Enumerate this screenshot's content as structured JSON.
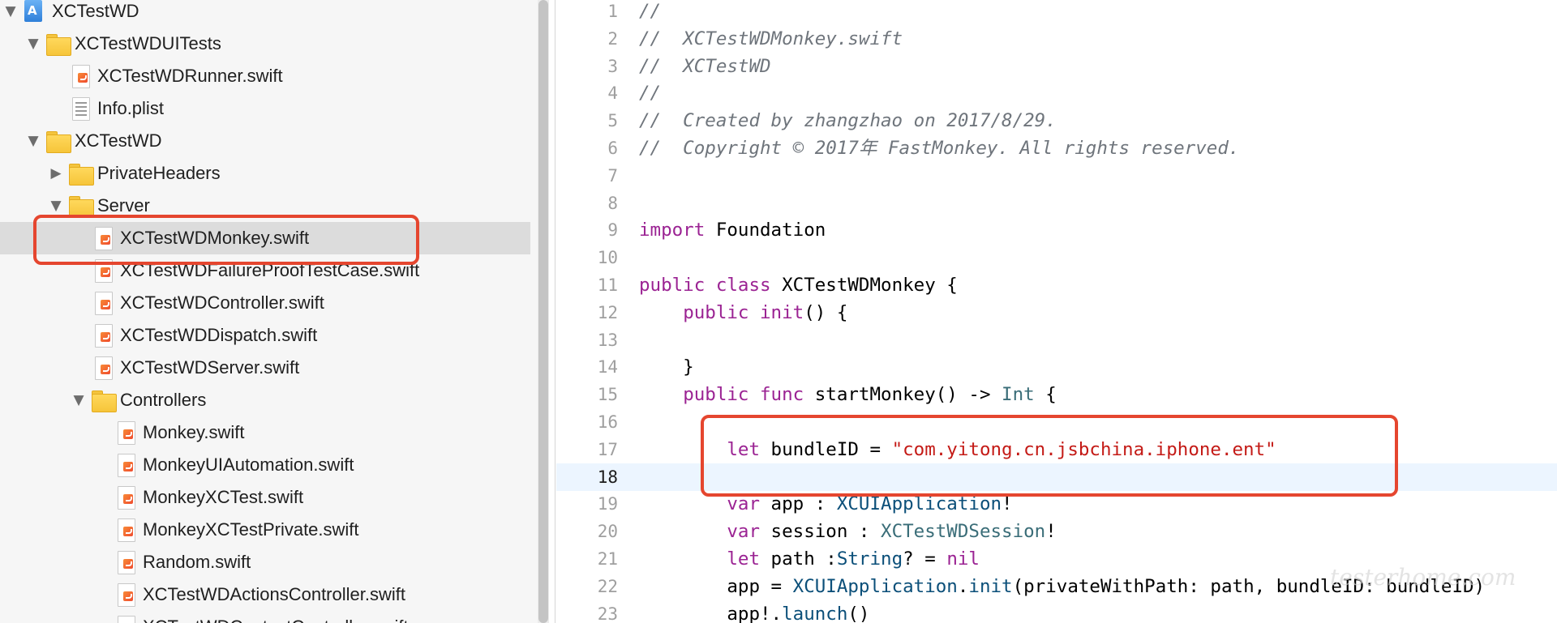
{
  "navigator": {
    "items": [
      {
        "label": "XCTestWD",
        "icon": "project-icon",
        "indent": 0,
        "disclosure": "expanded"
      },
      {
        "label": "XCTestWDUITests",
        "icon": "folder-icon",
        "indent": 1,
        "disclosure": "expanded"
      },
      {
        "label": "XCTestWDRunner.swift",
        "icon": "swift-file-icon",
        "indent": 2,
        "disclosure": "none"
      },
      {
        "label": "Info.plist",
        "icon": "plist-file-icon",
        "indent": 2,
        "disclosure": "none"
      },
      {
        "label": "XCTestWD",
        "icon": "folder-icon",
        "indent": 1,
        "disclosure": "expanded"
      },
      {
        "label": "PrivateHeaders",
        "icon": "folder-icon",
        "indent": 2,
        "disclosure": "collapsed"
      },
      {
        "label": "Server",
        "icon": "folder-icon",
        "indent": 2,
        "disclosure": "expanded"
      },
      {
        "label": "XCTestWDMonkey.swift",
        "icon": "swift-file-icon",
        "indent": 3,
        "disclosure": "none",
        "selected": true
      },
      {
        "label": "XCTestWDFailureProofTestCase.swift",
        "icon": "swift-file-icon",
        "indent": 3,
        "disclosure": "none"
      },
      {
        "label": "XCTestWDController.swift",
        "icon": "swift-file-icon",
        "indent": 3,
        "disclosure": "none"
      },
      {
        "label": "XCTestWDDispatch.swift",
        "icon": "swift-file-icon",
        "indent": 3,
        "disclosure": "none"
      },
      {
        "label": "XCTestWDServer.swift",
        "icon": "swift-file-icon",
        "indent": 3,
        "disclosure": "none"
      },
      {
        "label": "Controllers",
        "icon": "folder-icon",
        "indent": 3,
        "disclosure": "expanded"
      },
      {
        "label": "Monkey.swift",
        "icon": "swift-file-icon",
        "indent": 4,
        "disclosure": "none"
      },
      {
        "label": "MonkeyUIAutomation.swift",
        "icon": "swift-file-icon",
        "indent": 4,
        "disclosure": "none"
      },
      {
        "label": "MonkeyXCTest.swift",
        "icon": "swift-file-icon",
        "indent": 4,
        "disclosure": "none"
      },
      {
        "label": "MonkeyXCTestPrivate.swift",
        "icon": "swift-file-icon",
        "indent": 4,
        "disclosure": "none"
      },
      {
        "label": "Random.swift",
        "icon": "swift-file-icon",
        "indent": 4,
        "disclosure": "none"
      },
      {
        "label": "XCTestWDActionsController.swift",
        "icon": "swift-file-icon",
        "indent": 4,
        "disclosure": "none"
      },
      {
        "label": "XCTestWDContextController.swift",
        "icon": "swift-file-icon",
        "indent": 4,
        "disclosure": "none"
      }
    ]
  },
  "editor": {
    "current_line": 18,
    "lines": [
      {
        "number": "1",
        "tokens": [
          {
            "t": "//",
            "k": "comment"
          }
        ]
      },
      {
        "number": "2",
        "tokens": [
          {
            "t": "//  XCTestWDMonkey.swift",
            "k": "comment"
          }
        ]
      },
      {
        "number": "3",
        "tokens": [
          {
            "t": "//  XCTestWD",
            "k": "comment"
          }
        ]
      },
      {
        "number": "4",
        "tokens": [
          {
            "t": "//",
            "k": "comment"
          }
        ]
      },
      {
        "number": "5",
        "tokens": [
          {
            "t": "//  Created by zhangzhao on 2017/8/29.",
            "k": "comment"
          }
        ]
      },
      {
        "number": "6",
        "tokens": [
          {
            "t": "//  Copyright © 2017年 FastMonkey. All rights reserved.",
            "k": "comment"
          }
        ]
      },
      {
        "number": "7",
        "tokens": []
      },
      {
        "number": "8",
        "tokens": []
      },
      {
        "number": "9",
        "tokens": [
          {
            "t": "import",
            "k": "keyword"
          },
          {
            "t": " Foundation",
            "k": "plain"
          }
        ]
      },
      {
        "number": "10",
        "tokens": []
      },
      {
        "number": "11",
        "tokens": [
          {
            "t": "public class",
            "k": "keyword"
          },
          {
            "t": " XCTestWDMonkey {",
            "k": "plain"
          }
        ]
      },
      {
        "number": "12",
        "tokens": [
          {
            "t": "    ",
            "k": "plain"
          },
          {
            "t": "public init",
            "k": "keyword"
          },
          {
            "t": "() {",
            "k": "plain"
          }
        ]
      },
      {
        "number": "13",
        "tokens": []
      },
      {
        "number": "14",
        "tokens": [
          {
            "t": "    }",
            "k": "plain"
          }
        ]
      },
      {
        "number": "15",
        "tokens": [
          {
            "t": "    ",
            "k": "plain"
          },
          {
            "t": "public func",
            "k": "keyword"
          },
          {
            "t": " startMonkey() -> ",
            "k": "plain"
          },
          {
            "t": "Int",
            "k": "type"
          },
          {
            "t": " {",
            "k": "plain"
          }
        ]
      },
      {
        "number": "16",
        "tokens": []
      },
      {
        "number": "17",
        "tokens": [
          {
            "t": "        ",
            "k": "plain"
          },
          {
            "t": "let",
            "k": "keyword"
          },
          {
            "t": " bundleID = ",
            "k": "plain"
          },
          {
            "t": "\"com.yitong.cn.jsbchina.iphone.ent\"",
            "k": "string"
          }
        ]
      },
      {
        "number": "18",
        "tokens": []
      },
      {
        "number": "19",
        "tokens": [
          {
            "t": "        ",
            "k": "plain"
          },
          {
            "t": "var",
            "k": "keyword"
          },
          {
            "t": " app : ",
            "k": "plain"
          },
          {
            "t": "XCUIApplication",
            "k": "typename"
          },
          {
            "t": "!",
            "k": "plain"
          }
        ]
      },
      {
        "number": "20",
        "tokens": [
          {
            "t": "        ",
            "k": "plain"
          },
          {
            "t": "var",
            "k": "keyword"
          },
          {
            "t": " session : ",
            "k": "plain"
          },
          {
            "t": "XCTestWDSession",
            "k": "type"
          },
          {
            "t": "!",
            "k": "plain"
          }
        ]
      },
      {
        "number": "21",
        "tokens": [
          {
            "t": "        ",
            "k": "plain"
          },
          {
            "t": "let",
            "k": "keyword"
          },
          {
            "t": " path :",
            "k": "plain"
          },
          {
            "t": "String",
            "k": "typename"
          },
          {
            "t": "? = ",
            "k": "plain"
          },
          {
            "t": "nil",
            "k": "keyword"
          }
        ]
      },
      {
        "number": "22",
        "tokens": [
          {
            "t": "        app = ",
            "k": "plain"
          },
          {
            "t": "XCUIApplication",
            "k": "typename"
          },
          {
            "t": ".",
            "k": "plain"
          },
          {
            "t": "init",
            "k": "typename"
          },
          {
            "t": "(privateWithPath: path, bundleID: bundleID)",
            "k": "plain"
          }
        ]
      },
      {
        "number": "23",
        "tokens": [
          {
            "t": "        app!.",
            "k": "plain"
          },
          {
            "t": "launch",
            "k": "typename"
          },
          {
            "t": "()",
            "k": "plain"
          }
        ]
      }
    ]
  },
  "watermark": "testerhome.com",
  "colors": {
    "highlight_box": "#e5462f",
    "comment": "#6f757c",
    "keyword": "#9b2393",
    "string": "#c41a16",
    "type": "#3a6d78",
    "selection": "#dcdcdc",
    "current_line": "#ecf5ff"
  }
}
